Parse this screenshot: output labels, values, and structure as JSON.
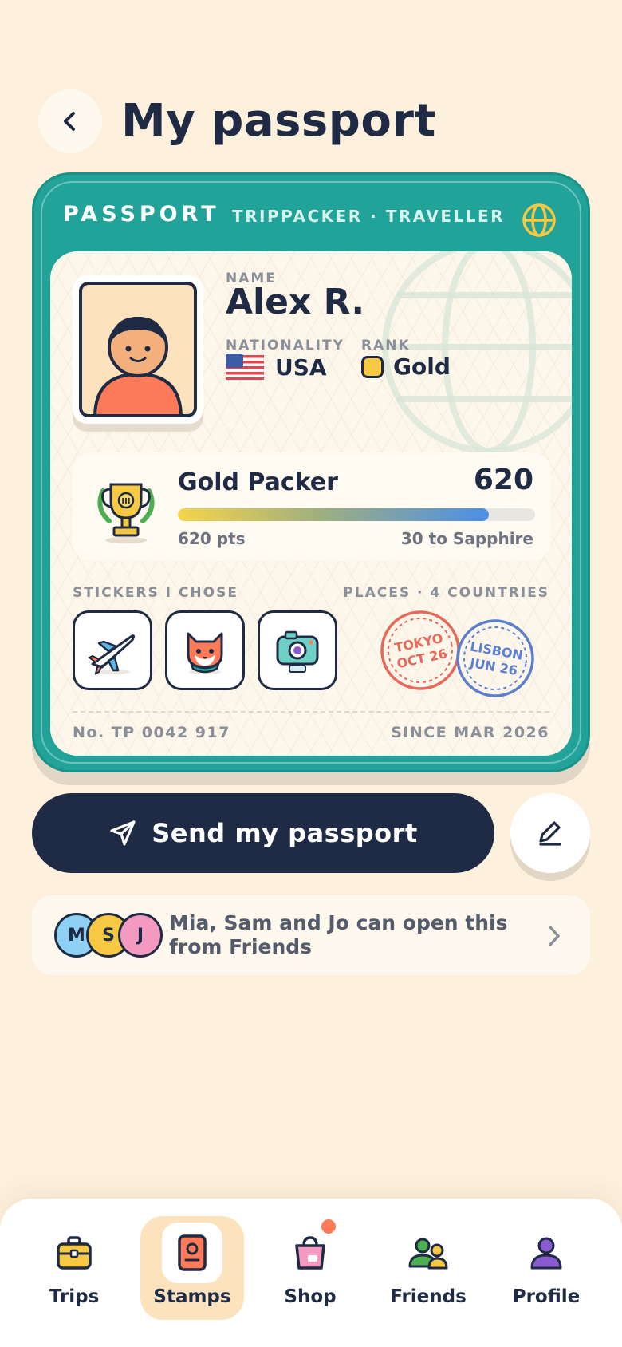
{
  "header": {
    "title": "My passport",
    "back_icon": "chevron-left-icon"
  },
  "passport": {
    "heading": "PASSPORT",
    "subheading": "TRIPPACKER · TRAVELLER",
    "name_label": "NAME",
    "name": "Alex R.",
    "nationality_label": "NATIONALITY",
    "nationality": "USA",
    "rank_label": "RANK",
    "rank": "Gold",
    "tier": {
      "name": "Gold Packer",
      "points": "620",
      "points_text": "620 pts",
      "remaining_text": "30 to Sapphire",
      "progress_fraction": 0.87
    },
    "stickers_label": "STICKERS I CHOSE",
    "stickers": [
      "airplane-sticker",
      "fox-sticker",
      "camera-sticker"
    ],
    "places_label": "PLACES · 4 COUNTRIES",
    "stamps": [
      {
        "city": "TOKYO",
        "date": "OCT 26",
        "color": "#e8695a"
      },
      {
        "city": "LISBON",
        "date": "JUN 26",
        "color": "#5b7fce"
      }
    ],
    "number": "No. TP 0042 917",
    "since": "SINCE MAR 2026"
  },
  "actions": {
    "send_label": "Send my passport",
    "edit_icon": "pencil-icon"
  },
  "friends": {
    "avatars": [
      {
        "initial": "M",
        "color": "#8fd0f5"
      },
      {
        "initial": "S",
        "color": "#f7c842"
      },
      {
        "initial": "J",
        "color": "#f49ac1"
      }
    ],
    "text": "Mia, Sam and Jo can open this from Friends"
  },
  "nav": {
    "items": [
      {
        "label": "Trips",
        "icon": "suitcase-icon"
      },
      {
        "label": "Stamps",
        "icon": "passport-icon",
        "active": true
      },
      {
        "label": "Shop",
        "icon": "shopping-bag-icon",
        "badge": true
      },
      {
        "label": "Friends",
        "icon": "friends-icon"
      },
      {
        "label": "Profile",
        "icon": "profile-icon"
      }
    ]
  },
  "colors": {
    "background": "#fdf0dd",
    "card_teal": "#21a39a",
    "navy": "#1f2a44",
    "active_tab": "#fde3bd",
    "badge": "#ff7a59"
  }
}
